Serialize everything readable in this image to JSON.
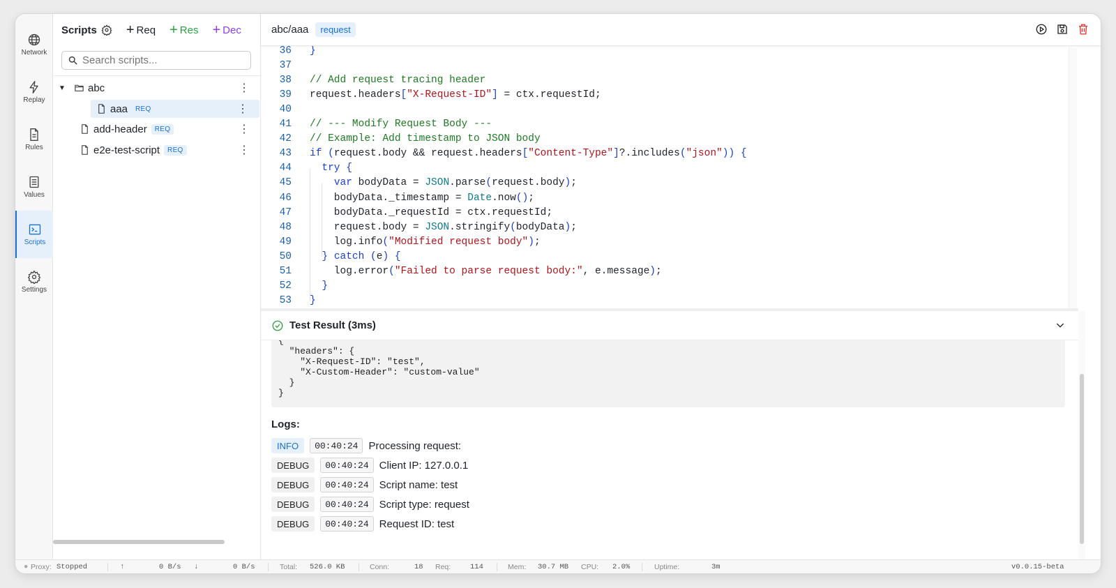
{
  "rail": [
    {
      "label": "Network",
      "icon": "globe-icon"
    },
    {
      "label": "Replay",
      "icon": "bolt-icon"
    },
    {
      "label": "Rules",
      "icon": "document-icon"
    },
    {
      "label": "Values",
      "icon": "list-icon"
    },
    {
      "label": "Scripts",
      "icon": "terminal-icon",
      "active": true
    },
    {
      "label": "Settings",
      "icon": "gear-icon"
    }
  ],
  "sidebar": {
    "title": "Scripts",
    "buttons": [
      {
        "label": "Req",
        "color": "#1f2328"
      },
      {
        "label": "Res",
        "color": "#2ea043"
      },
      {
        "label": "Dec",
        "color": "#8a3ff5"
      }
    ],
    "search_placeholder": "Search scripts...",
    "tree": [
      {
        "type": "folder",
        "name": "abc"
      },
      {
        "type": "file",
        "name": "aaa",
        "badge": "REQ",
        "selected": true
      },
      {
        "type": "file",
        "name": "add-header",
        "badge": "REQ"
      },
      {
        "type": "file",
        "name": "e2e-test-script",
        "badge": "REQ"
      }
    ]
  },
  "editor": {
    "path": "abc/aaa",
    "tag": "request",
    "lines": [
      {
        "n": "36",
        "t": "}"
      },
      {
        "n": "37",
        "t": ""
      },
      {
        "n": "38",
        "t": "// Add request tracing header"
      },
      {
        "n": "39",
        "t": "request.headers[\"X-Request-ID\"] = ctx.requestId;"
      },
      {
        "n": "40",
        "t": ""
      },
      {
        "n": "41",
        "t": "// --- Modify Request Body ---"
      },
      {
        "n": "42",
        "t": "// Example: Add timestamp to JSON body"
      },
      {
        "n": "43",
        "t": "if (request.body && request.headers[\"Content-Type\"]?.includes(\"json\")) {"
      },
      {
        "n": "44",
        "t": "  try {"
      },
      {
        "n": "45",
        "t": "    var bodyData = JSON.parse(request.body);"
      },
      {
        "n": "46",
        "t": "    bodyData._timestamp = Date.now();"
      },
      {
        "n": "47",
        "t": "    bodyData._requestId = ctx.requestId;"
      },
      {
        "n": "48",
        "t": "    request.body = JSON.stringify(bodyData);"
      },
      {
        "n": "49",
        "t": "    log.info(\"Modified request body\");"
      },
      {
        "n": "50",
        "t": "  } catch (e) {"
      },
      {
        "n": "51",
        "t": "    log.error(\"Failed to parse request body:\", e.message);"
      },
      {
        "n": "52",
        "t": "  }"
      },
      {
        "n": "53",
        "t": "}"
      }
    ]
  },
  "result": {
    "title": "Test Result (3ms)",
    "json": "{\n  \"headers\": {\n    \"X-Request-ID\": \"test\",\n    \"X-Custom-Header\": \"custom-value\"\n  }\n}",
    "logs_title": "Logs:",
    "logs": [
      {
        "level": "INFO",
        "time": "00:40:24",
        "msg": "Processing request:"
      },
      {
        "level": "DEBUG",
        "time": "00:40:24",
        "msg": "Client IP: 127.0.0.1"
      },
      {
        "level": "DEBUG",
        "time": "00:40:24",
        "msg": "Script name: test"
      },
      {
        "level": "DEBUG",
        "time": "00:40:24",
        "msg": "Script type: request"
      },
      {
        "level": "DEBUG",
        "time": "00:40:24",
        "msg": "Request ID: test"
      }
    ]
  },
  "status": {
    "proxy_label": "Proxy:",
    "proxy_value": "Stopped",
    "up_rate": "0 B/s",
    "down_rate": "0 B/s",
    "total_label": "Total:",
    "total_value": "526.0 KB",
    "conn_label": "Conn:",
    "conn_value": "18",
    "req_label": "Req:",
    "req_value": "114",
    "mem_label": "Mem:",
    "mem_value": "30.7 MB",
    "cpu_label": "CPU:",
    "cpu_value": "2.0%",
    "uptime_label": "Uptime:",
    "uptime_value": "3m",
    "version": "v0.0.15-beta"
  }
}
